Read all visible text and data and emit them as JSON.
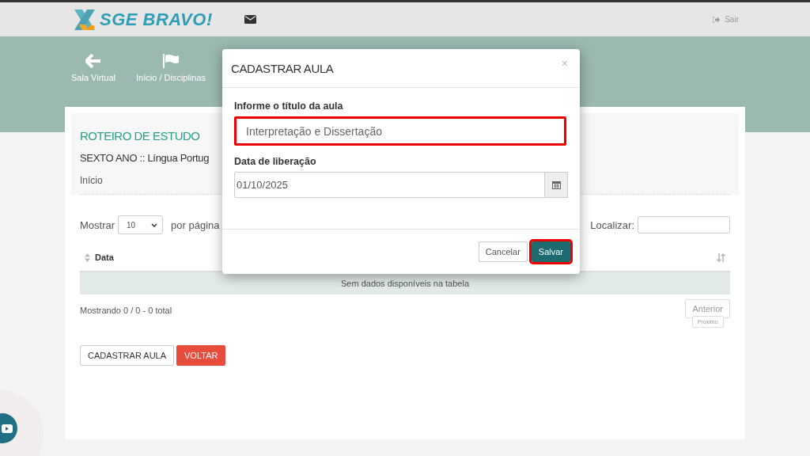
{
  "header": {
    "logo_text": "SGE BRAVO!",
    "logout": "Sair"
  },
  "nav": [
    {
      "label": "Sala Virtual",
      "kind": "back"
    },
    {
      "label": "Início / Disciplinas",
      "kind": "flag"
    }
  ],
  "page": {
    "title": "ROTEIRO DE ESTUDO",
    "subtitle": "SEXTO ANO :: Língua Portug",
    "breadcrumb": "Início"
  },
  "table_controls": {
    "show_label": "Mostrar",
    "page_size": "10",
    "per_page_label": "por página",
    "search_label": "Localizar:"
  },
  "table": {
    "columns": [
      "Data"
    ],
    "empty_message": "Sem dados disponíveis na tabela"
  },
  "info": "Mostrando 0 / 0 - 0 total",
  "pagination": [
    "Anterior",
    "Próximo"
  ],
  "actions": [
    {
      "label": "CADASTRAR AULA",
      "kind": "default"
    },
    {
      "label": "VOLTAR",
      "kind": "danger"
    }
  ],
  "modal": {
    "title": "CADASTRAR AULA",
    "close": "×",
    "fields": [
      {
        "label": "Informe o título da aula",
        "value": "Interpretação e Dissertação",
        "highlighted": true,
        "kind": "text"
      },
      {
        "label": "Data de liberação",
        "value": "01/10/2025",
        "highlighted": false,
        "kind": "date"
      }
    ],
    "buttons": [
      {
        "label": "Cancelar",
        "kind": "default",
        "highlighted": false
      },
      {
        "label": "Salvar",
        "kind": "primary",
        "highlighted": true
      }
    ]
  }
}
